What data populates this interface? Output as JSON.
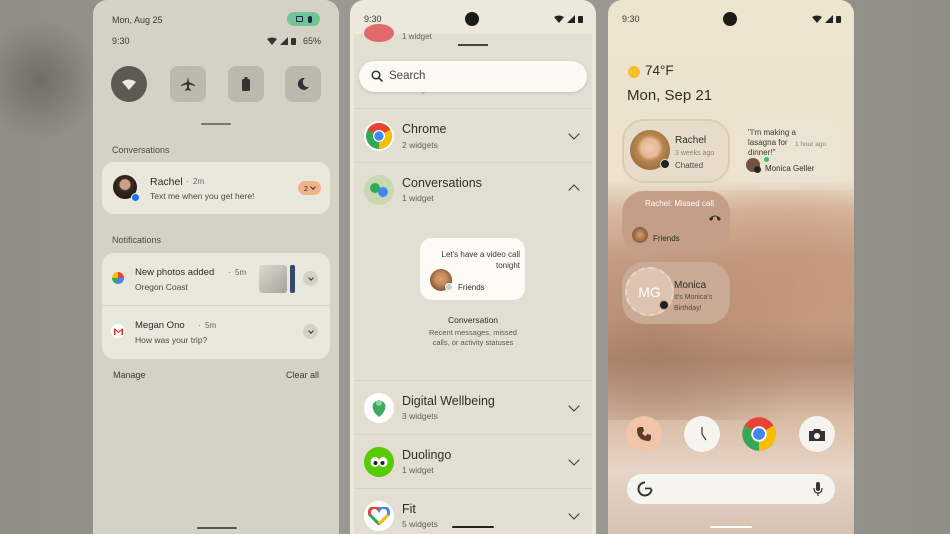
{
  "panel1": {
    "date": "Mon, Aug 25",
    "time": "9:30",
    "battery": "65%",
    "section_conversations": "Conversations",
    "conversation": {
      "name": "Rachel",
      "ago": "2m",
      "message": "Text me when you get here!",
      "count": "2"
    },
    "section_notifications": "Notifications",
    "notifications": [
      {
        "title": "New photos added",
        "ago": "5m",
        "subtitle": "Oregon Coast"
      },
      {
        "title": "Megan Ono",
        "ago": "5m",
        "subtitle": "How was your trip?"
      }
    ],
    "manage": "Manage",
    "clear_all": "Clear all"
  },
  "panel2": {
    "time": "9:30",
    "top_partial": "1 widget",
    "search_placeholder": "Search",
    "partial_below_search": "2 widgets",
    "apps": [
      {
        "name": "Chrome",
        "count": "2 widgets"
      },
      {
        "name": "Conversations",
        "count": "1 widget"
      },
      {
        "name": "Digital Wellbeing",
        "count": "3 widgets"
      },
      {
        "name": "Duolingo",
        "count": "1 widget"
      },
      {
        "name": "Fit",
        "count": "5 widgets"
      }
    ],
    "preview": {
      "message": "Let's have a video call tonight",
      "group": "Friends",
      "title": "Conversation",
      "description": "Recent messages, missed calls, or activity statuses"
    }
  },
  "panel3": {
    "time": "9:30",
    "weather": "74°F",
    "date": "Mon, Sep 21",
    "widgets": {
      "rachel": {
        "name": "Rachel",
        "ago": "3 weeks ago",
        "status": "Chatted"
      },
      "monica_msg": {
        "message": "\"I'm making a lasagna for dinner!\"",
        "ago": "1 hour ago",
        "name": "Monica Geller"
      },
      "missed": {
        "title": "Rachel: Missed call",
        "group": "Friends"
      },
      "monica": {
        "initials": "MG",
        "name": "Monica",
        "note": "It's Monica's Birthday!"
      }
    }
  }
}
